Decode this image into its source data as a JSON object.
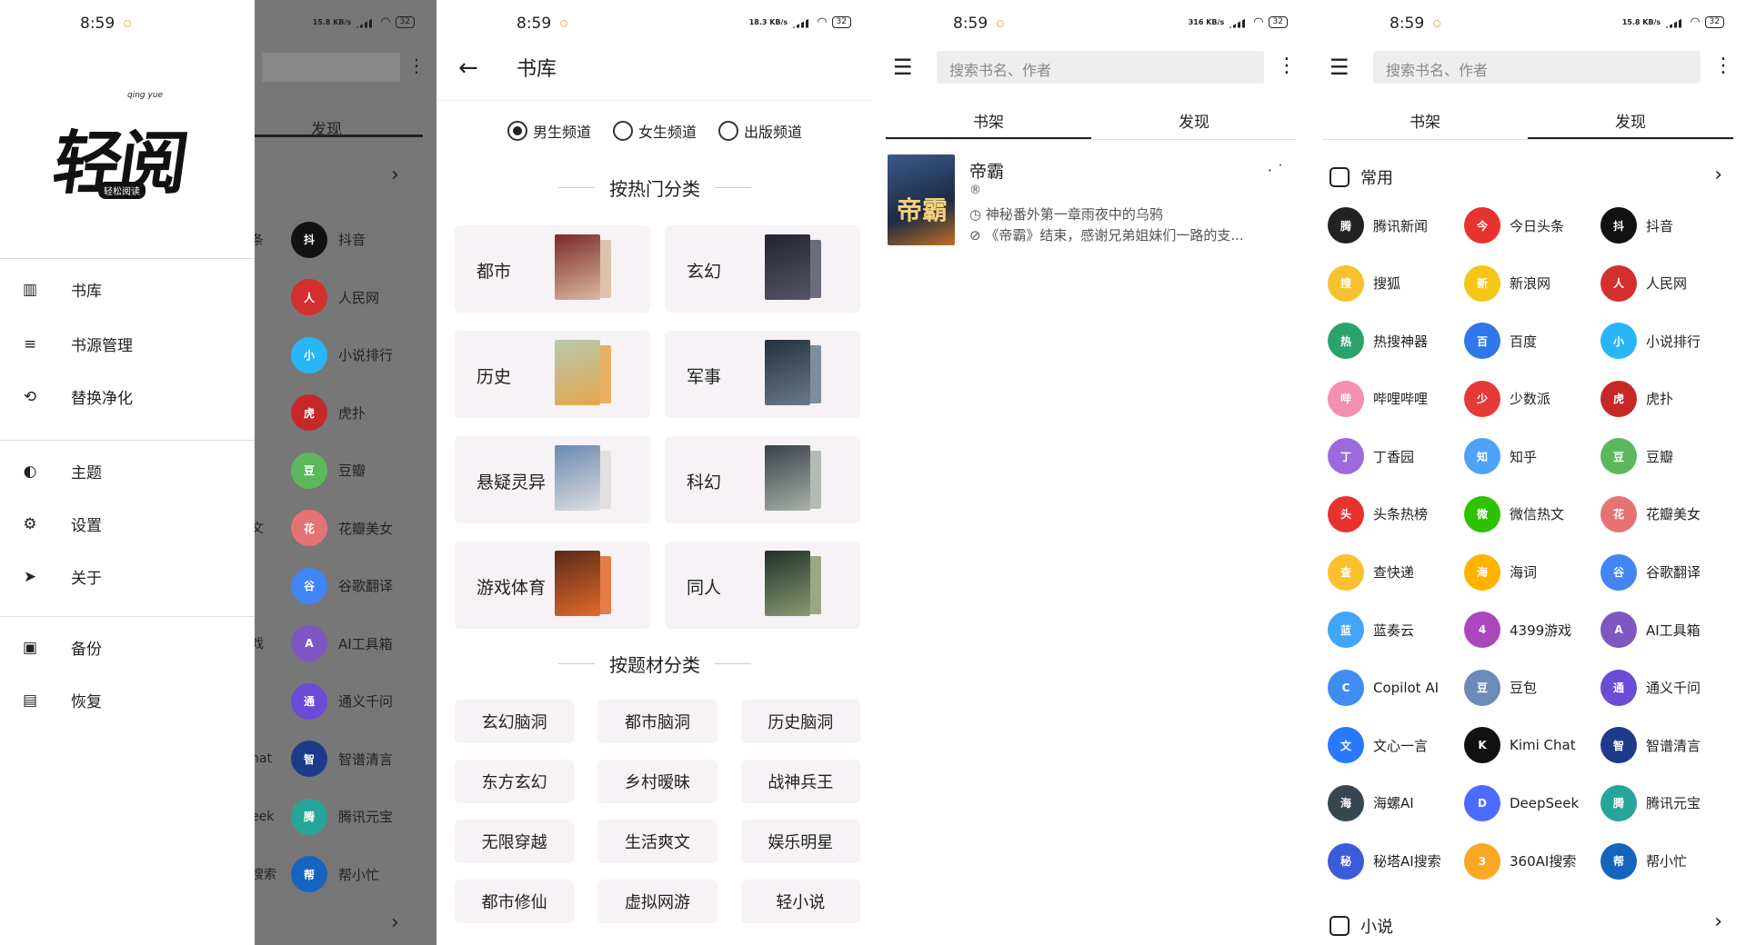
{
  "status": {
    "time": "8:59",
    "net_speed_1": "15.8 KB/s",
    "net_speed_2": "18.3 KB/s",
    "net_speed_3": "316 KB/s",
    "battery": "32"
  },
  "drawer": {
    "logo_pinyin": "qing yue",
    "logo_text": "轻阅",
    "logo_sub": "轻松阅读",
    "items": [
      {
        "label": "书库",
        "icon": "library-icon"
      },
      {
        "label": "书源管理",
        "icon": "list-icon"
      },
      {
        "label": "替换净化",
        "icon": "search-replace-icon"
      },
      {
        "label": "主题",
        "icon": "palette-icon"
      },
      {
        "label": "设置",
        "icon": "gear-icon"
      },
      {
        "label": "关于",
        "icon": "send-icon"
      },
      {
        "label": "备份",
        "icon": "backup-icon"
      },
      {
        "label": "恢复",
        "icon": "restore-icon"
      }
    ],
    "under_tab": "发现",
    "under_left": [
      "条",
      "",
      "",
      "",
      "",
      "文",
      "",
      "戏",
      "",
      "hat",
      "eek",
      "搜索"
    ],
    "under_items": [
      "抖音",
      "人民网",
      "小说排行",
      "虎扑",
      "豆瓣",
      "花瓣美女",
      "谷歌翻译",
      "AI工具箱",
      "通义千问",
      "智谱清言",
      "腾讯元宝",
      "帮小忙"
    ]
  },
  "library": {
    "title": "书库",
    "channels": [
      "男生频道",
      "女生频道",
      "出版频道"
    ],
    "selected_channel": "男生频道",
    "section_hot": "按热门分类",
    "categories": [
      "都市",
      "玄幻",
      "历史",
      "军事",
      "悬疑灵异",
      "科幻",
      "游戏体育",
      "同人"
    ],
    "section_theme": "按题材分类",
    "themes": [
      "玄幻脑洞",
      "都市脑洞",
      "历史脑洞",
      "东方玄幻",
      "乡村暧昧",
      "战神兵王",
      "无限穿越",
      "生活爽文",
      "娱乐明星",
      "都市修仙",
      "虚拟网游",
      "轻小说"
    ]
  },
  "shelf": {
    "search_placeholder": "搜索书名、作者",
    "tabs": [
      "书架",
      "发现"
    ],
    "book": {
      "cover_text": "帝霸",
      "title": "帝霸",
      "author_line": "®",
      "last_chapter": "神秘番外第一章雨夜中的乌鸦",
      "latest": "《帝霸》结束，感谢兄弟姐妹们一路的支..."
    }
  },
  "discover": {
    "group_common": "常用",
    "group_novel": "小说",
    "items": [
      {
        "label": "腾讯新闻",
        "color": "#222222"
      },
      {
        "label": "今日头条",
        "color": "#e8322d"
      },
      {
        "label": "抖音",
        "color": "#111111"
      },
      {
        "label": "搜狐",
        "color": "#f6c22d"
      },
      {
        "label": "新浪网",
        "color": "#f5c518"
      },
      {
        "label": "人民网",
        "color": "#d32f2f"
      },
      {
        "label": "热搜神器",
        "color": "#2aa36b"
      },
      {
        "label": "百度",
        "color": "#3077e8"
      },
      {
        "label": "小说排行",
        "color": "#29b6f6"
      },
      {
        "label": "哔哩哔哩",
        "color": "#f48fb1"
      },
      {
        "label": "少数派",
        "color": "#e53935"
      },
      {
        "label": "虎扑",
        "color": "#c62828"
      },
      {
        "label": "丁香园",
        "color": "#9c6ade"
      },
      {
        "label": "知乎",
        "color": "#4fa3f7"
      },
      {
        "label": "豆瓣",
        "color": "#5cb85c"
      },
      {
        "label": "头条热榜",
        "color": "#e8322d"
      },
      {
        "label": "微信热文",
        "color": "#2dc100"
      },
      {
        "label": "花瓣美女",
        "color": "#e57373"
      },
      {
        "label": "查快递",
        "color": "#fbc02d"
      },
      {
        "label": "海词",
        "color": "#ffb300"
      },
      {
        "label": "谷歌翻译",
        "color": "#4285f4"
      },
      {
        "label": "蓝奏云",
        "color": "#42a5f5"
      },
      {
        "label": "4399游戏",
        "color": "#ab47bc"
      },
      {
        "label": "AI工具箱",
        "color": "#7e57c2"
      },
      {
        "label": "Copilot AI",
        "color": "#3f8cf2"
      },
      {
        "label": "豆包",
        "color": "#6d8ab8"
      },
      {
        "label": "通义千问",
        "color": "#6a4cd6"
      },
      {
        "label": "文心一言",
        "color": "#2979ff"
      },
      {
        "label": "Kimi Chat",
        "color": "#111111"
      },
      {
        "label": "智谱清言",
        "color": "#1e3a8a"
      },
      {
        "label": "海螺AI",
        "color": "#37474f"
      },
      {
        "label": "DeepSeek",
        "color": "#4d6bfe"
      },
      {
        "label": "腾讯元宝",
        "color": "#26a69a"
      },
      {
        "label": "秘塔AI搜索",
        "color": "#3b5bdb"
      },
      {
        "label": "360AI搜索",
        "color": "#f9a825"
      },
      {
        "label": "帮小忙",
        "color": "#1565c0"
      }
    ]
  }
}
